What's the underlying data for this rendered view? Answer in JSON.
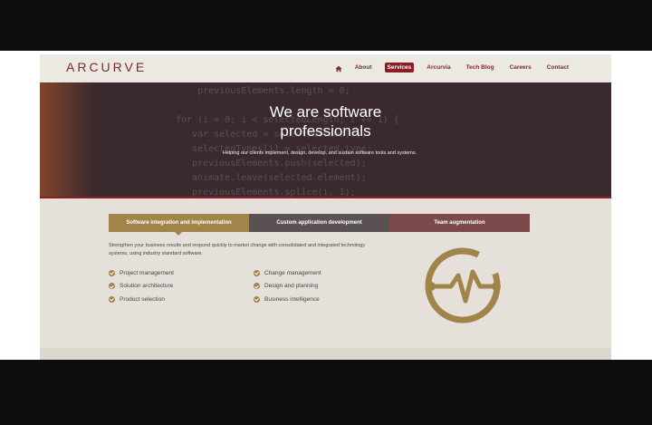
{
  "header": {
    "logo": "ARCURVE",
    "nav": [
      {
        "label": "About"
      },
      {
        "label": "Services",
        "active": true
      },
      {
        "label": "Arcurvia"
      },
      {
        "label": "Tech Blog"
      },
      {
        "label": "Careers"
      },
      {
        "label": "Contact"
      }
    ],
    "home_icon": "home-icon"
  },
  "hero": {
    "title_line1": "We are software",
    "title_line2": "professionals",
    "subtitle": "Helping our clients implement, design, develop, and sustain software tools and systems."
  },
  "services": {
    "tabs": [
      {
        "label": "Software integration and implementation"
      },
      {
        "label": "Custom application development"
      },
      {
        "label": "Team augmentation"
      }
    ],
    "intro": "Strengthen your business results and respond quickly to market change with consolidated and integrated technology systems, using industry standard software.",
    "list_left": [
      "Project management",
      "Solution architecture",
      "Product selection"
    ],
    "list_right": [
      "Change management",
      "Design and planning",
      "Business intelligence"
    ]
  },
  "colors": {
    "brand_red": "#8c1d24",
    "gold": "#a08449",
    "tab_gray": "#5a5252",
    "tab_maroon": "#7a4a4a"
  }
}
